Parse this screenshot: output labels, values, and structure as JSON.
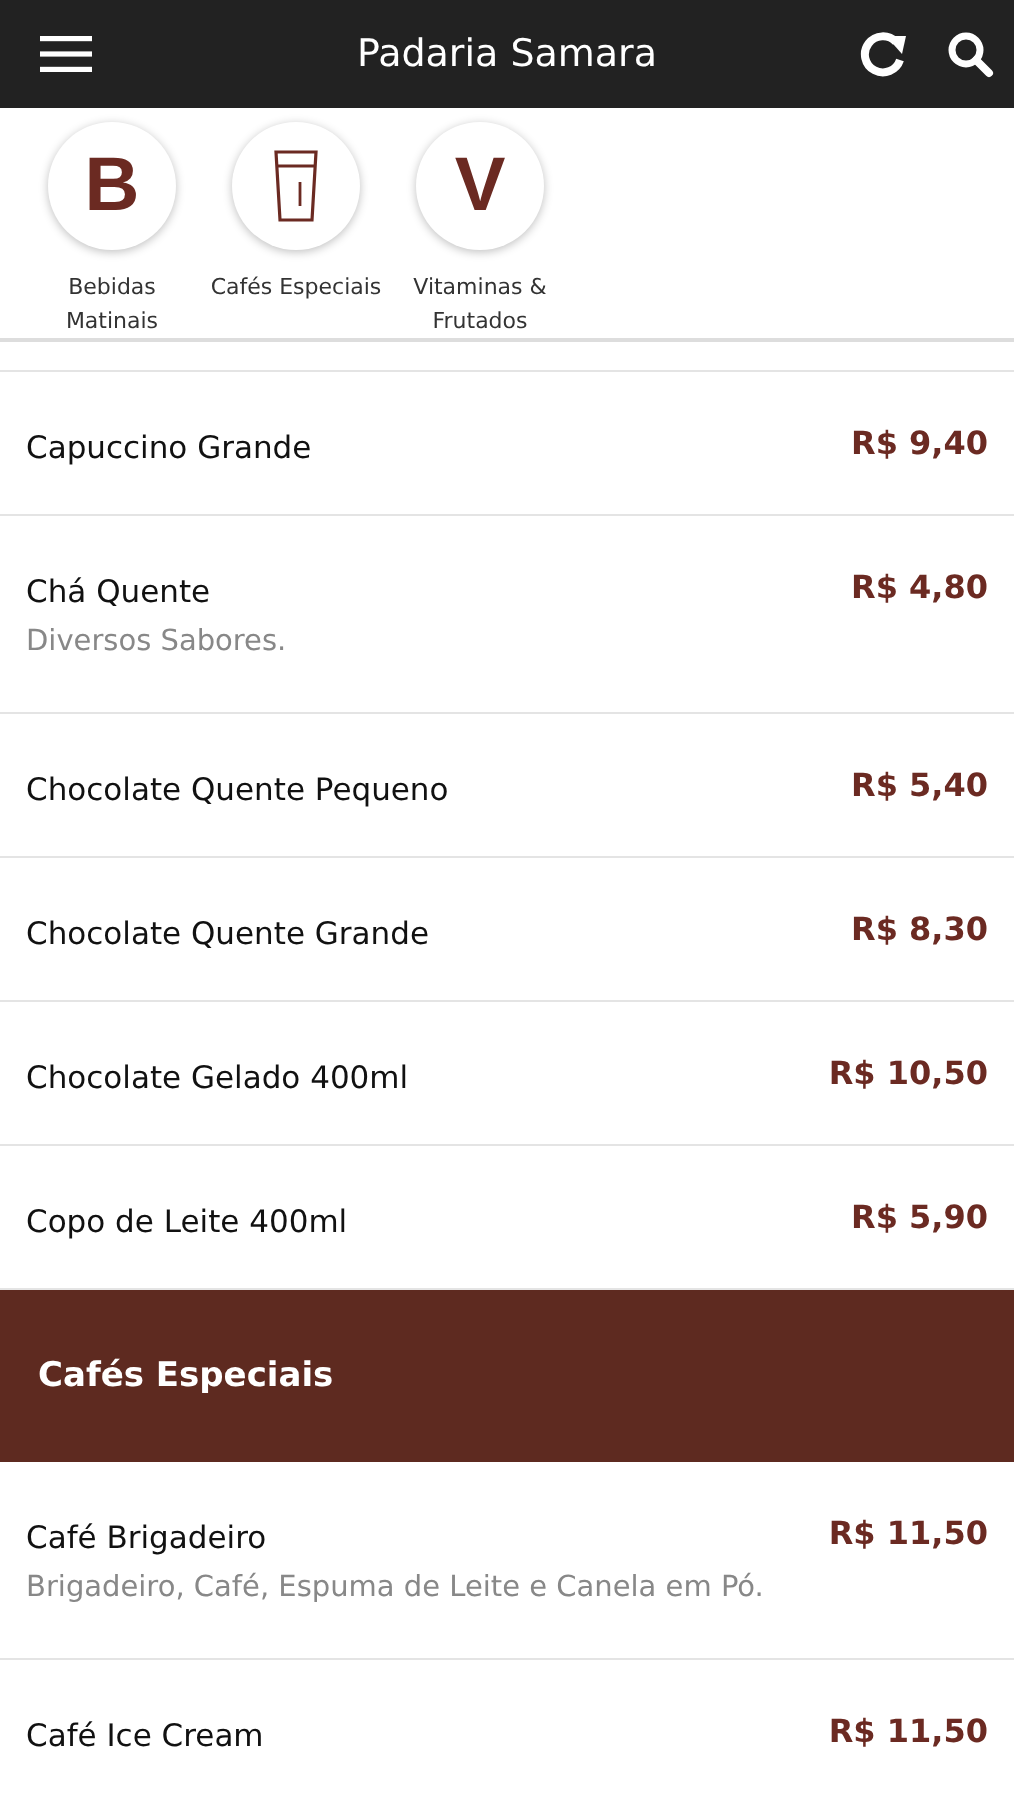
{
  "app_bar": {
    "title": "Padaria Samara"
  },
  "categories": [
    {
      "kind": "letter",
      "glyph": "B",
      "label": "Bebidas Matinais"
    },
    {
      "kind": "glass",
      "label": "Cafés Especiais"
    },
    {
      "kind": "letter",
      "glyph": "V",
      "label": "Vitaminas & Frutados"
    }
  ],
  "menu": [
    {
      "kind": "item",
      "name": "Capuccino Grande",
      "price": "R$ 9,40"
    },
    {
      "kind": "item",
      "name": "Chá Quente",
      "description": "Diversos Sabores.",
      "price": "R$ 4,80"
    },
    {
      "kind": "item",
      "name": "Chocolate Quente Pequeno",
      "price": "R$ 5,40"
    },
    {
      "kind": "item",
      "name": "Chocolate Quente Grande",
      "price": "R$ 8,30"
    },
    {
      "kind": "item",
      "name": "Chocolate Gelado 400ml",
      "price": "R$ 10,50"
    },
    {
      "kind": "item",
      "name": "Copo de Leite 400ml",
      "price": "R$ 5,90"
    },
    {
      "kind": "section",
      "name": "Cafés Especiais"
    },
    {
      "kind": "item",
      "name": "Café Brigadeiro",
      "description": "Brigadeiro, Café, Espuma de Leite e Canela em Pó.",
      "price": "R$ 11,50"
    },
    {
      "kind": "item",
      "name": "Café Ice Cream",
      "price": "R$ 11,50"
    }
  ]
}
